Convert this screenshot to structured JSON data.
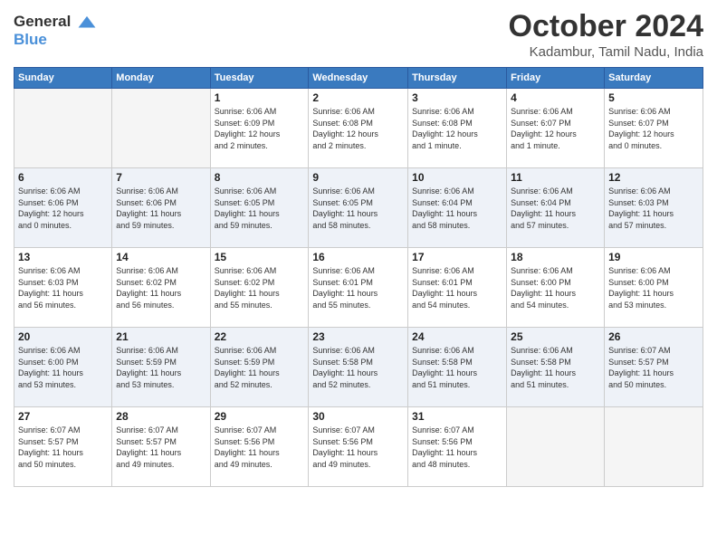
{
  "header": {
    "logo_line1": "General",
    "logo_line2": "Blue",
    "month": "October 2024",
    "location": "Kadambur, Tamil Nadu, India"
  },
  "days_of_week": [
    "Sunday",
    "Monday",
    "Tuesday",
    "Wednesday",
    "Thursday",
    "Friday",
    "Saturday"
  ],
  "weeks": [
    [
      {
        "day": "",
        "info": ""
      },
      {
        "day": "",
        "info": ""
      },
      {
        "day": "1",
        "info": "Sunrise: 6:06 AM\nSunset: 6:09 PM\nDaylight: 12 hours\nand 2 minutes."
      },
      {
        "day": "2",
        "info": "Sunrise: 6:06 AM\nSunset: 6:08 PM\nDaylight: 12 hours\nand 2 minutes."
      },
      {
        "day": "3",
        "info": "Sunrise: 6:06 AM\nSunset: 6:08 PM\nDaylight: 12 hours\nand 1 minute."
      },
      {
        "day": "4",
        "info": "Sunrise: 6:06 AM\nSunset: 6:07 PM\nDaylight: 12 hours\nand 1 minute."
      },
      {
        "day": "5",
        "info": "Sunrise: 6:06 AM\nSunset: 6:07 PM\nDaylight: 12 hours\nand 0 minutes."
      }
    ],
    [
      {
        "day": "6",
        "info": "Sunrise: 6:06 AM\nSunset: 6:06 PM\nDaylight: 12 hours\nand 0 minutes."
      },
      {
        "day": "7",
        "info": "Sunrise: 6:06 AM\nSunset: 6:06 PM\nDaylight: 11 hours\nand 59 minutes."
      },
      {
        "day": "8",
        "info": "Sunrise: 6:06 AM\nSunset: 6:05 PM\nDaylight: 11 hours\nand 59 minutes."
      },
      {
        "day": "9",
        "info": "Sunrise: 6:06 AM\nSunset: 6:05 PM\nDaylight: 11 hours\nand 58 minutes."
      },
      {
        "day": "10",
        "info": "Sunrise: 6:06 AM\nSunset: 6:04 PM\nDaylight: 11 hours\nand 58 minutes."
      },
      {
        "day": "11",
        "info": "Sunrise: 6:06 AM\nSunset: 6:04 PM\nDaylight: 11 hours\nand 57 minutes."
      },
      {
        "day": "12",
        "info": "Sunrise: 6:06 AM\nSunset: 6:03 PM\nDaylight: 11 hours\nand 57 minutes."
      }
    ],
    [
      {
        "day": "13",
        "info": "Sunrise: 6:06 AM\nSunset: 6:03 PM\nDaylight: 11 hours\nand 56 minutes."
      },
      {
        "day": "14",
        "info": "Sunrise: 6:06 AM\nSunset: 6:02 PM\nDaylight: 11 hours\nand 56 minutes."
      },
      {
        "day": "15",
        "info": "Sunrise: 6:06 AM\nSunset: 6:02 PM\nDaylight: 11 hours\nand 55 minutes."
      },
      {
        "day": "16",
        "info": "Sunrise: 6:06 AM\nSunset: 6:01 PM\nDaylight: 11 hours\nand 55 minutes."
      },
      {
        "day": "17",
        "info": "Sunrise: 6:06 AM\nSunset: 6:01 PM\nDaylight: 11 hours\nand 54 minutes."
      },
      {
        "day": "18",
        "info": "Sunrise: 6:06 AM\nSunset: 6:00 PM\nDaylight: 11 hours\nand 54 minutes."
      },
      {
        "day": "19",
        "info": "Sunrise: 6:06 AM\nSunset: 6:00 PM\nDaylight: 11 hours\nand 53 minutes."
      }
    ],
    [
      {
        "day": "20",
        "info": "Sunrise: 6:06 AM\nSunset: 6:00 PM\nDaylight: 11 hours\nand 53 minutes."
      },
      {
        "day": "21",
        "info": "Sunrise: 6:06 AM\nSunset: 5:59 PM\nDaylight: 11 hours\nand 53 minutes."
      },
      {
        "day": "22",
        "info": "Sunrise: 6:06 AM\nSunset: 5:59 PM\nDaylight: 11 hours\nand 52 minutes."
      },
      {
        "day": "23",
        "info": "Sunrise: 6:06 AM\nSunset: 5:58 PM\nDaylight: 11 hours\nand 52 minutes."
      },
      {
        "day": "24",
        "info": "Sunrise: 6:06 AM\nSunset: 5:58 PM\nDaylight: 11 hours\nand 51 minutes."
      },
      {
        "day": "25",
        "info": "Sunrise: 6:06 AM\nSunset: 5:58 PM\nDaylight: 11 hours\nand 51 minutes."
      },
      {
        "day": "26",
        "info": "Sunrise: 6:07 AM\nSunset: 5:57 PM\nDaylight: 11 hours\nand 50 minutes."
      }
    ],
    [
      {
        "day": "27",
        "info": "Sunrise: 6:07 AM\nSunset: 5:57 PM\nDaylight: 11 hours\nand 50 minutes."
      },
      {
        "day": "28",
        "info": "Sunrise: 6:07 AM\nSunset: 5:57 PM\nDaylight: 11 hours\nand 49 minutes."
      },
      {
        "day": "29",
        "info": "Sunrise: 6:07 AM\nSunset: 5:56 PM\nDaylight: 11 hours\nand 49 minutes."
      },
      {
        "day": "30",
        "info": "Sunrise: 6:07 AM\nSunset: 5:56 PM\nDaylight: 11 hours\nand 49 minutes."
      },
      {
        "day": "31",
        "info": "Sunrise: 6:07 AM\nSunset: 5:56 PM\nDaylight: 11 hours\nand 48 minutes."
      },
      {
        "day": "",
        "info": ""
      },
      {
        "day": "",
        "info": ""
      }
    ]
  ]
}
